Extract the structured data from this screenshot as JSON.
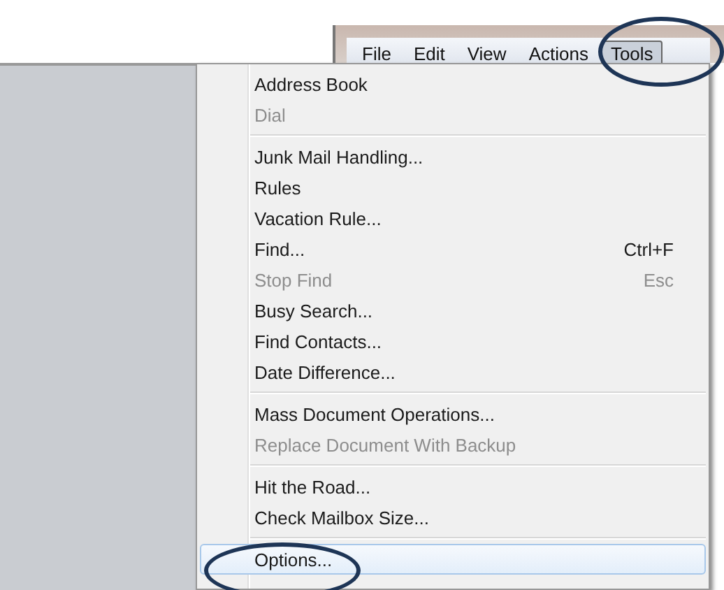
{
  "menu_bar": [
    {
      "label": "File",
      "selected": false
    },
    {
      "label": "Edit",
      "selected": false
    },
    {
      "label": "View",
      "selected": false
    },
    {
      "label": "Actions",
      "selected": false
    },
    {
      "label": "Tools",
      "selected": true
    }
  ],
  "menu": [
    {
      "kind": "item",
      "label": "Address Book",
      "disabled": false,
      "selected": false
    },
    {
      "kind": "item",
      "label": "Dial",
      "disabled": true,
      "selected": false
    },
    {
      "kind": "separator"
    },
    {
      "kind": "item",
      "label": "Junk Mail Handling...",
      "disabled": false,
      "selected": false
    },
    {
      "kind": "item",
      "label": "Rules",
      "disabled": false,
      "selected": false
    },
    {
      "kind": "item",
      "label": "Vacation Rule...",
      "disabled": false,
      "selected": false
    },
    {
      "kind": "item",
      "label": "Find...",
      "shortcut": "Ctrl+F",
      "disabled": false,
      "selected": false
    },
    {
      "kind": "item",
      "label": "Stop Find",
      "shortcut": "Esc",
      "disabled": true,
      "selected": false
    },
    {
      "kind": "item",
      "label": "Busy Search...",
      "disabled": false,
      "selected": false
    },
    {
      "kind": "item",
      "label": "Find Contacts...",
      "disabled": false,
      "selected": false
    },
    {
      "kind": "item",
      "label": "Date Difference...",
      "disabled": false,
      "selected": false
    },
    {
      "kind": "separator"
    },
    {
      "kind": "item",
      "label": "Mass Document Operations...",
      "disabled": false,
      "selected": false
    },
    {
      "kind": "item",
      "label": "Replace Document With Backup",
      "disabled": true,
      "selected": false
    },
    {
      "kind": "separator"
    },
    {
      "kind": "item",
      "label": "Hit the Road...",
      "disabled": false,
      "selected": false
    },
    {
      "kind": "item",
      "label": "Check Mailbox Size...",
      "disabled": false,
      "selected": false
    },
    {
      "kind": "separator"
    },
    {
      "kind": "item",
      "label": "Options...",
      "disabled": false,
      "selected": true
    }
  ]
}
